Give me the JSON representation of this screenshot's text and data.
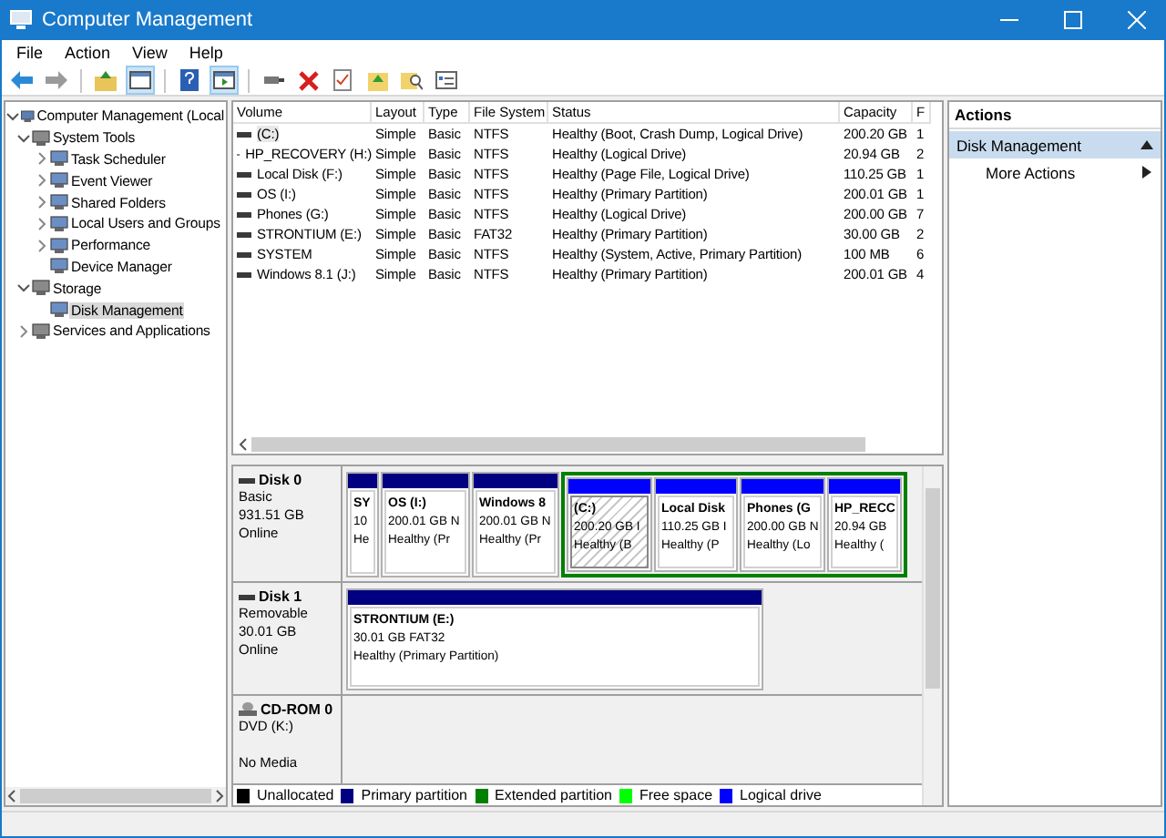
{
  "window": {
    "title": "Computer Management"
  },
  "menu": [
    "File",
    "Action",
    "View",
    "Help"
  ],
  "tree": [
    {
      "label": "Computer Management (Local",
      "expanded": true,
      "selected": false,
      "children": [
        {
          "label": "System Tools",
          "expanded": true,
          "selected": false,
          "children": [
            {
              "label": "Task Scheduler",
              "expanded": false,
              "selected": false
            },
            {
              "label": "Event Viewer",
              "expanded": false,
              "selected": false
            },
            {
              "label": "Shared Folders",
              "expanded": false,
              "selected": false
            },
            {
              "label": "Local Users and Groups",
              "expanded": false,
              "selected": false
            },
            {
              "label": "Performance",
              "expanded": false,
              "selected": false
            },
            {
              "label": "Device Manager",
              "selected": false
            }
          ]
        },
        {
          "label": "Storage",
          "expanded": true,
          "selected": false,
          "children": [
            {
              "label": "Disk Management",
              "selected": true
            }
          ]
        },
        {
          "label": "Services and Applications",
          "expanded": false,
          "selected": false
        }
      ]
    }
  ],
  "table": {
    "columns": [
      "Volume",
      "Layout",
      "Type",
      "File System",
      "Status",
      "Capacity",
      "F"
    ],
    "rows": [
      {
        "selected": true,
        "cells": [
          "(C:)",
          "Simple",
          "Basic",
          "NTFS",
          "Healthy (Boot, Crash Dump, Logical Drive)",
          "200.20 GB",
          "1"
        ]
      },
      {
        "selected": false,
        "cells": [
          "HP_RECOVERY (H:)",
          "Simple",
          "Basic",
          "NTFS",
          "Healthy (Logical Drive)",
          "20.94 GB",
          "2"
        ]
      },
      {
        "selected": false,
        "cells": [
          "Local Disk (F:)",
          "Simple",
          "Basic",
          "NTFS",
          "Healthy (Page File, Logical Drive)",
          "110.25 GB",
          "1"
        ]
      },
      {
        "selected": false,
        "cells": [
          "OS (I:)",
          "Simple",
          "Basic",
          "NTFS",
          "Healthy (Primary Partition)",
          "200.01 GB",
          "1"
        ]
      },
      {
        "selected": false,
        "cells": [
          "Phones (G:)",
          "Simple",
          "Basic",
          "NTFS",
          "Healthy (Logical Drive)",
          "200.00 GB",
          "7"
        ]
      },
      {
        "selected": false,
        "cells": [
          "STRONTIUM (E:)",
          "Simple",
          "Basic",
          "FAT32",
          "Healthy (Primary Partition)",
          "30.00 GB",
          "2"
        ]
      },
      {
        "selected": false,
        "cells": [
          "SYSTEM",
          "Simple",
          "Basic",
          "NTFS",
          "Healthy (System, Active, Primary Partition)",
          "100 MB",
          "6"
        ]
      },
      {
        "selected": false,
        "cells": [
          "Windows 8.1 (J:)",
          "Simple",
          "Basic",
          "NTFS",
          "Healthy (Primary Partition)",
          "200.01 GB",
          "4"
        ]
      }
    ]
  },
  "disks": [
    {
      "kind": "disk",
      "name": "Disk 0",
      "lines": [
        "Basic",
        "931.51 GB",
        "Online"
      ],
      "partitions": [
        {
          "kind": "primary",
          "selected": false,
          "title": "SY",
          "size": "10",
          "status": "He"
        },
        {
          "kind": "primary",
          "selected": false,
          "title": "OS  (I:)",
          "size": "200.01 GB N",
          "status": "Healthy (Pr"
        },
        {
          "kind": "primary",
          "selected": false,
          "title": "Windows 8",
          "size": "200.01 GB N",
          "status": "Healthy (Pr"
        },
        {
          "kind": "logical",
          "selected": true,
          "title": "(C:)",
          "size": "200.20 GB I",
          "status": "Healthy (B"
        },
        {
          "kind": "logical",
          "selected": false,
          "title": "Local Disk",
          "size": "110.25 GB I",
          "status": "Healthy (P"
        },
        {
          "kind": "logical",
          "selected": false,
          "title": "Phones  (G",
          "size": "200.00 GB N",
          "status": "Healthy (Lo"
        },
        {
          "kind": "logical",
          "selected": false,
          "title": "HP_RECC",
          "size": "20.94 GB",
          "status": "Healthy ("
        }
      ]
    },
    {
      "kind": "disk",
      "name": "Disk 1",
      "lines": [
        "Removable",
        "30.01 GB",
        "Online"
      ],
      "partitions": [
        {
          "kind": "primary",
          "selected": false,
          "title": "STRONTIUM  (E:)",
          "size": "30.01 GB FAT32",
          "status": "Healthy (Primary Partition)"
        }
      ]
    },
    {
      "kind": "cdrom",
      "name": "CD-ROM 0",
      "lines": [
        "DVD (K:)",
        "No Media"
      ]
    }
  ],
  "legend": [
    {
      "label": "Unallocated",
      "color": "#000000"
    },
    {
      "label": "Primary partition",
      "color": "#000080"
    },
    {
      "label": "Extended partition",
      "color": "#008000"
    },
    {
      "label": "Free space",
      "color": "#00ff00"
    },
    {
      "label": "Logical drive",
      "color": "#0000ff"
    }
  ],
  "actions": {
    "title": "Actions",
    "section": "Disk Management",
    "items": [
      "More Actions"
    ]
  }
}
